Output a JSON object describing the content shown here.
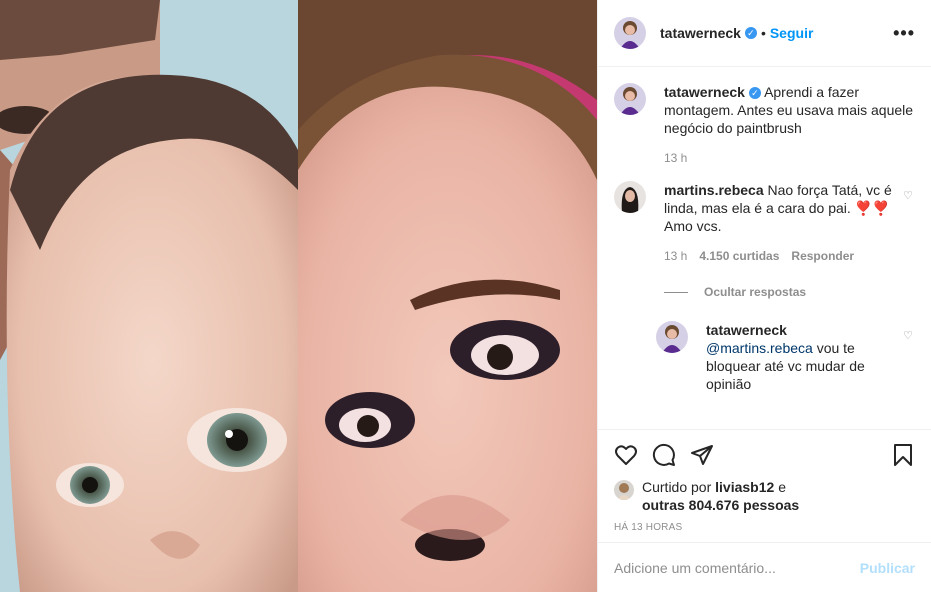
{
  "post": {
    "author": "tatawerneck",
    "verified": true,
    "dot": "•",
    "follow_label": "Seguir",
    "more_label": "•••"
  },
  "caption": {
    "username": "tatawerneck",
    "text": "Aprendi a fazer montagem. Antes eu usava mais aquele negócio do paintbrush",
    "time": "13 h"
  },
  "comments": [
    {
      "username": "martins.rebeca",
      "text": "Nao força Tatá, vc é linda, mas ela é a cara do pai. ❣️❣️ Amo vcs.",
      "time": "13 h",
      "likes": "4.150 curtidas",
      "reply_label": "Responder"
    }
  ],
  "hide_replies_label": "Ocultar respostas",
  "reply": {
    "username": "tatawerneck",
    "mention": "@martins.rebeca",
    "text": " vou te bloquear até vc mudar de opinião"
  },
  "likes": {
    "prefix": "Curtido por",
    "user": "liviasb12",
    "middle": "e",
    "others": "outras 804.676 pessoas"
  },
  "timestamp": "HÁ 13 HORAS",
  "add_comment": {
    "placeholder": "Adicione um comentário...",
    "publish_label": "Publicar"
  },
  "colors": {
    "accent": "#0095f6",
    "verified": "#3897f0",
    "muted": "#8e8e8e"
  },
  "icons": [
    "heart-icon",
    "comment-icon",
    "share-icon",
    "bookmark-icon",
    "verified-icon",
    "small-heart-icon"
  ]
}
